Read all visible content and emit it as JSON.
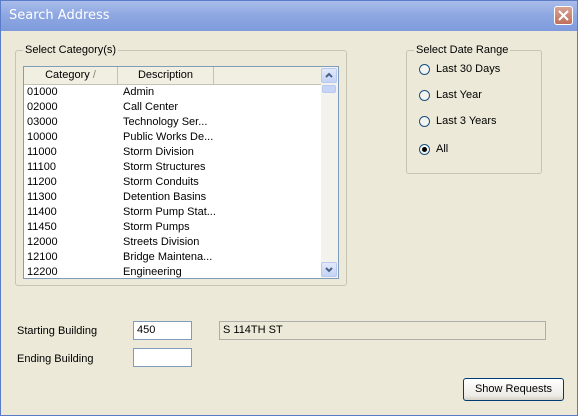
{
  "window": {
    "title": "Search Address"
  },
  "category_group": {
    "legend": "Select Category(s)",
    "columns": [
      "Category",
      "Description"
    ],
    "sort_indicator": "/",
    "rows": [
      {
        "code": "01000",
        "desc": "Admin"
      },
      {
        "code": "02000",
        "desc": "Call Center"
      },
      {
        "code": "03000",
        "desc": "Technology Ser..."
      },
      {
        "code": "10000",
        "desc": "Public Works De..."
      },
      {
        "code": "11000",
        "desc": "Storm Division"
      },
      {
        "code": "11100",
        "desc": "Storm Structures"
      },
      {
        "code": "11200",
        "desc": "Storm Conduits"
      },
      {
        "code": "11300",
        "desc": "Detention Basins"
      },
      {
        "code": "11400",
        "desc": "Storm Pump Stat..."
      },
      {
        "code": "11450",
        "desc": "Storm Pumps"
      },
      {
        "code": "12000",
        "desc": "Streets Division"
      },
      {
        "code": "12100",
        "desc": "Bridge Maintena..."
      },
      {
        "code": "12200",
        "desc": "Engineering"
      }
    ]
  },
  "date_range": {
    "legend": "Select Date Range",
    "options": [
      "Last 30 Days",
      "Last Year",
      "Last 3 Years",
      "All"
    ],
    "selected": "All"
  },
  "fields": {
    "starting_label": "Starting Building",
    "starting_value": "450",
    "street_value": "S 114TH ST",
    "ending_label": "Ending Building",
    "ending_value": ""
  },
  "buttons": {
    "show_requests": "Show Requests"
  },
  "colors": {
    "titlebar": "#8fa8e2",
    "dialog_bg": "#ece9d8",
    "close_button": "#c06f5b"
  }
}
